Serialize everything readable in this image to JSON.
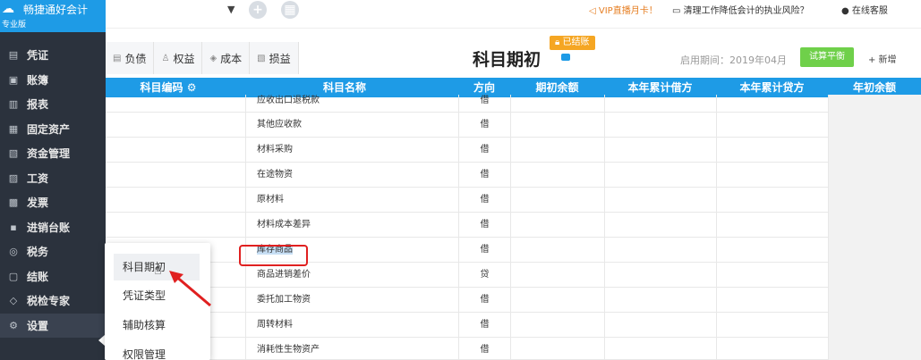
{
  "brand": {
    "name": "畅捷通好会计",
    "edition": "专业版"
  },
  "topbar": {
    "combo_value": "",
    "vip_text": "VIP直播月卡！",
    "promo_text": "清理工作降低会计的执业风险？",
    "online_text": "在线客服"
  },
  "sidebar": {
    "items": [
      {
        "label": "凭证",
        "icon": "voucher-icon"
      },
      {
        "label": "账簿",
        "icon": "ledger-icon"
      },
      {
        "label": "报表",
        "icon": "report-icon"
      },
      {
        "label": "固定资产",
        "icon": "asset-icon"
      },
      {
        "label": "资金管理",
        "icon": "fund-icon"
      },
      {
        "label": "工资",
        "icon": "salary-icon"
      },
      {
        "label": "发票",
        "icon": "invoice-icon"
      },
      {
        "label": "进销台账",
        "icon": "trade-icon"
      },
      {
        "label": "税务",
        "icon": "tax-icon"
      },
      {
        "label": "结账",
        "icon": "close-icon"
      },
      {
        "label": "税检专家",
        "icon": "shield-icon"
      },
      {
        "label": "设置",
        "icon": "gear-icon"
      }
    ]
  },
  "tabs": [
    {
      "label": "负债"
    },
    {
      "label": "权益"
    },
    {
      "label": "成本"
    },
    {
      "label": "损益"
    }
  ],
  "page": {
    "title": "科目期初",
    "closed_badge": "已结账",
    "period_label": "启用期间：",
    "period_value": "2019年04月",
    "trial_balance": "试算平衡",
    "add": "+ 新增"
  },
  "table": {
    "headers": [
      "科目编码",
      "科目名称",
      "方向",
      "期初余额",
      "本年累计借方",
      "本年累计贷方",
      "年初余额"
    ],
    "rows": [
      {
        "name": "应收出口退税款",
        "dir": "借"
      },
      {
        "name": "其他应收款",
        "dir": "借"
      },
      {
        "name": "材料采购",
        "dir": "借"
      },
      {
        "name": "在途物资",
        "dir": "借"
      },
      {
        "name": "原材料",
        "dir": "借"
      },
      {
        "name": "材料成本差异",
        "dir": "借"
      },
      {
        "name": "库存商品",
        "dir": "借"
      },
      {
        "name": "商品进销差价",
        "dir": "贷"
      },
      {
        "name": "委托加工物资",
        "dir": "借"
      },
      {
        "name": "周转材料",
        "dir": "借"
      },
      {
        "name": "消耗性生物资产",
        "dir": "借"
      }
    ]
  },
  "popup": {
    "items": [
      {
        "label": "科目期初"
      },
      {
        "label": "凭证类型"
      },
      {
        "label": "辅助核算"
      },
      {
        "label": "权限管理"
      }
    ]
  },
  "colors": {
    "accent": "#1e9be6",
    "sidebar": "#2b323d",
    "highlight": "#e02020",
    "badge": "#f5a623",
    "trial": "#6fd04a"
  }
}
